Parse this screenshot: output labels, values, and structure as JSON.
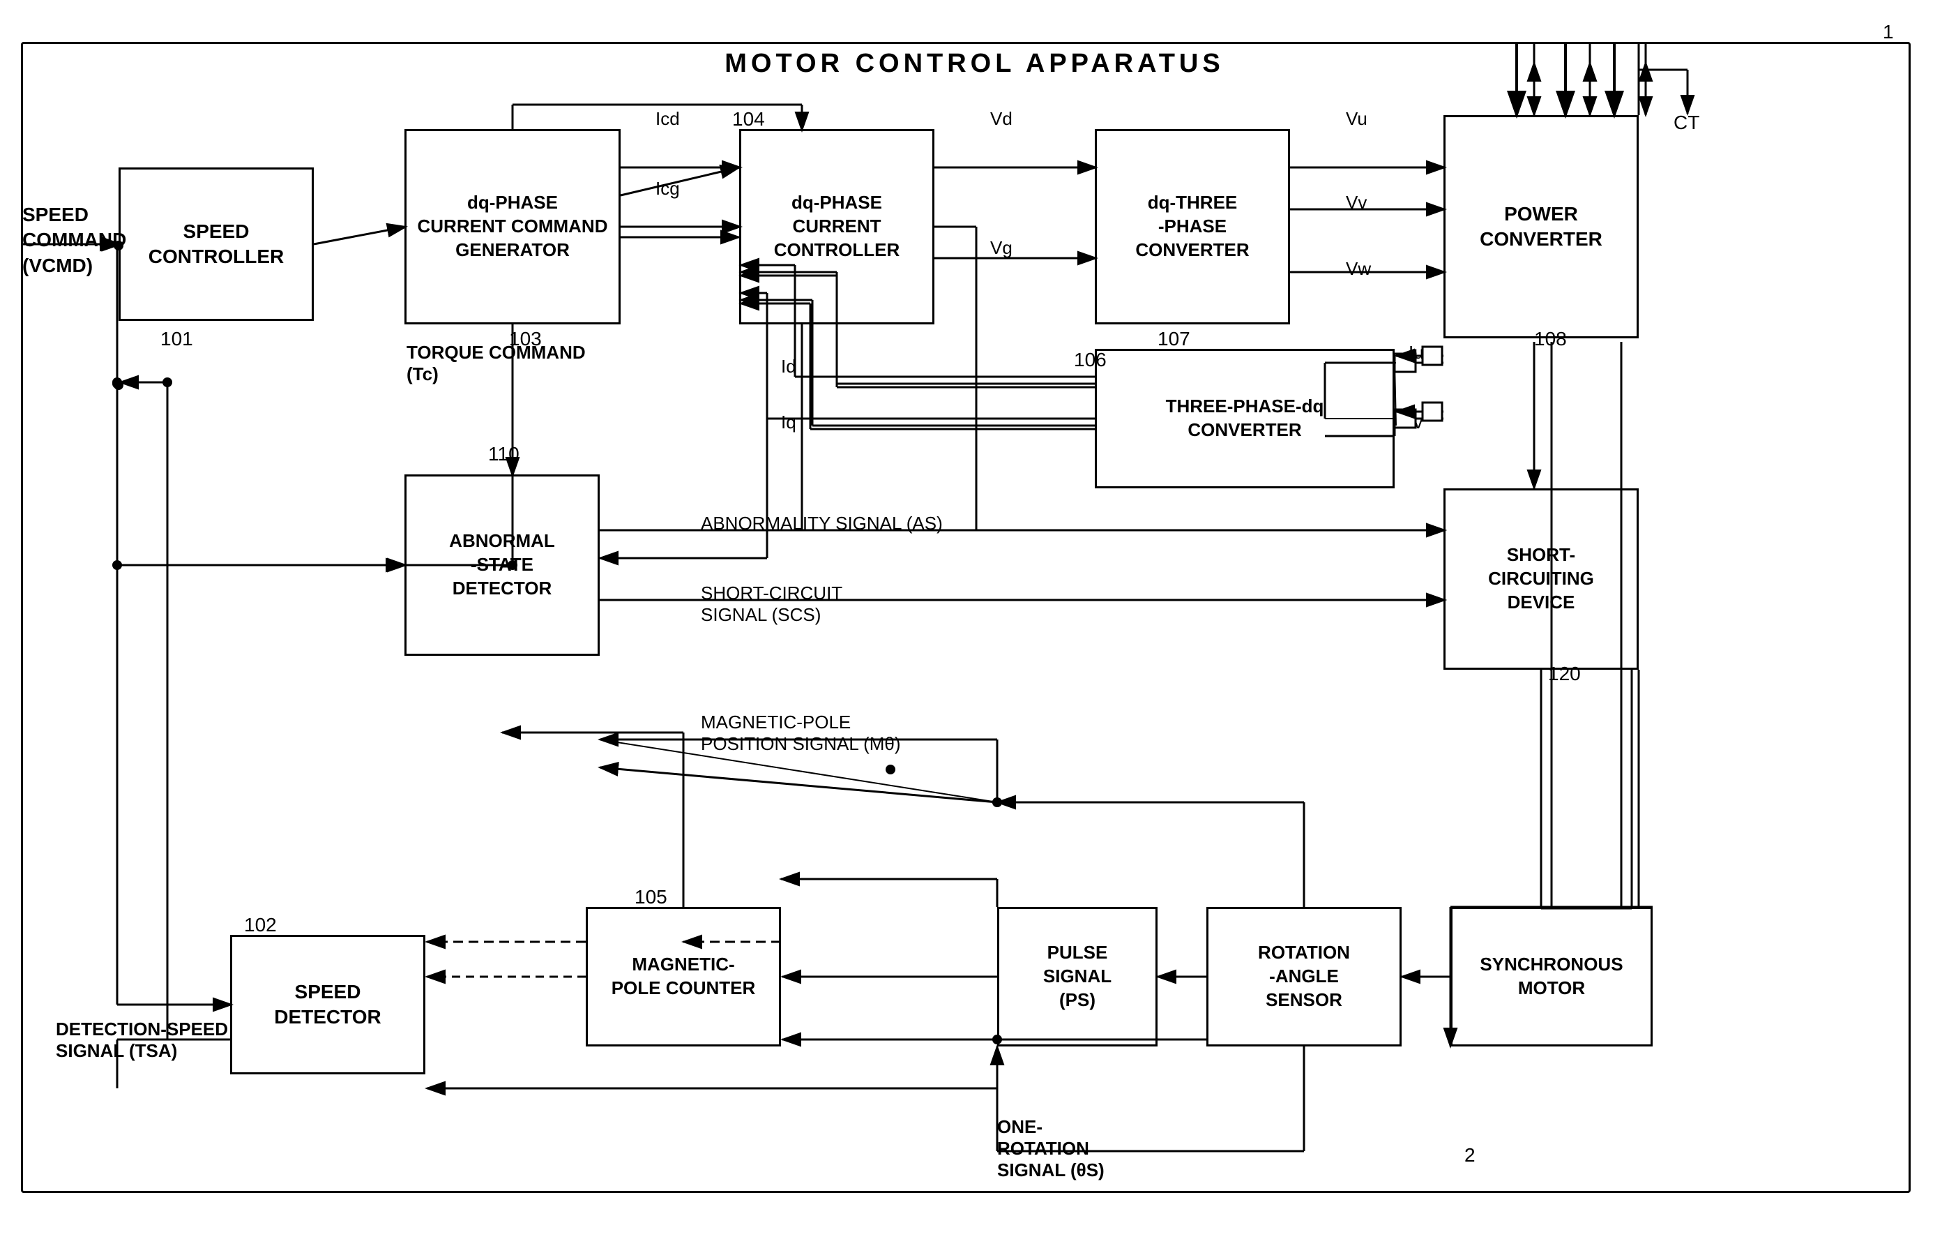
{
  "title": "MOTOR CONTROL APPARATUS",
  "ref1": "1",
  "ref2": "2",
  "blocks": {
    "speed_controller": {
      "label": "SPEED\nCONTROLLER",
      "ref": "101"
    },
    "dq_phase_current_cmd": {
      "label": "dq-PHASE\nCURRENT COMMAND\nGENERATOR",
      "ref": "103"
    },
    "dq_phase_current_ctrl": {
      "label": "dq-PHASE\nCURRENT\nCONTROLLER",
      "ref": "104"
    },
    "dq_three_phase": {
      "label": "dq-THREE\n-PHASE\nCONVERTER",
      "ref": "107"
    },
    "power_converter": {
      "label": "POWER\nCONVERTER",
      "ref": "108"
    },
    "three_phase_dq": {
      "label": "THREE-PHASE-dq\nCONVERTER",
      "ref": "106"
    },
    "abnormal_state": {
      "label": "ABNORMAL\n-STATE\nDETECTOR",
      "ref": "110"
    },
    "short_circuiting": {
      "label": "SHORT-\nCIRCUITING\nDEVICE",
      "ref": "120"
    },
    "speed_detector": {
      "label": "SPEED\nDETECTOR",
      "ref": "102"
    },
    "magnetic_pole": {
      "label": "MAGNETIC-\nPOLE COUNTER",
      "ref": "105"
    },
    "pulse_signal": {
      "label": "PULSE\nSIGNAL\n(PS)"
    },
    "rotation_angle": {
      "label": "ROTATION\n-ANGLE\nSENSOR"
    },
    "synchronous_motor": {
      "label": "SYNCHRONOUS\nMOTOR"
    }
  },
  "signals": {
    "speed_command": "SPEED\nCOMMAND\n(VCMD)",
    "torque_command": "TORQUE COMMAND\n(Tc)",
    "icd": "Icd",
    "icg": "Icg",
    "vd": "Vd",
    "vg": "Vg",
    "vu": "Vu",
    "vv": "Vv",
    "vw": "Vw",
    "id": "Id",
    "iq": "Iq",
    "iu": "Iu",
    "iv": "Iv",
    "ct": "CT",
    "abnormality_signal": "ABNORMALITY SIGNAL (AS)",
    "short_circuit_signal": "SHORT-CIRCUIT\nSIGNAL (SCS)",
    "magnetic_pole_signal": "MAGNETIC-POLE\nPOSITION SIGNAL (Mθ)",
    "detection_speed": "DETECTION-SPEED\nSIGNAL (TSA)",
    "one_rotation": "ONE-\nROTATION\nSIGNAL (θS)"
  }
}
